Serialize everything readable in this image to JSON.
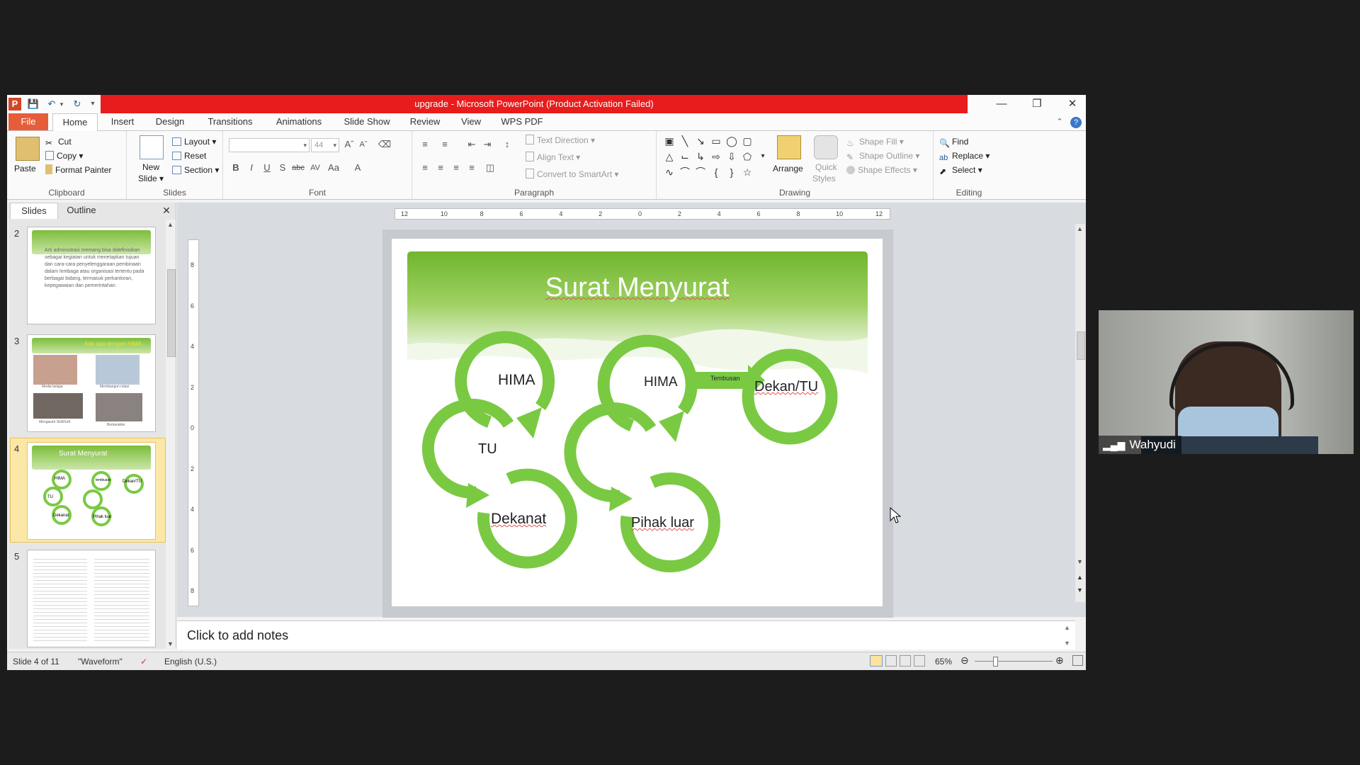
{
  "window": {
    "title": "upgrade - Microsoft PowerPoint (Product Activation Failed)",
    "accent_red": "#e81c1c"
  },
  "tabs": [
    "File",
    "Home",
    "Insert",
    "Design",
    "Transitions",
    "Animations",
    "Slide Show",
    "Review",
    "View",
    "WPS PDF"
  ],
  "ribbon": {
    "clipboard": {
      "label": "Clipboard",
      "paste": "Paste",
      "cut": "Cut",
      "copy": "Copy",
      "format_painter": "Format Painter"
    },
    "slides": {
      "label": "Slides",
      "new_slide": "New",
      "new_slide2": "Slide",
      "layout": "Layout",
      "reset": "Reset",
      "section": "Section"
    },
    "font": {
      "label": "Font",
      "size": "44"
    },
    "paragraph": {
      "label": "Paragraph",
      "text_direction": "Text Direction",
      "align_text": "Align Text",
      "convert_smartart": "Convert to SmartArt"
    },
    "drawing": {
      "label": "Drawing",
      "arrange": "Arrange",
      "quick_styles": "Quick",
      "quick_styles2": "Styles",
      "shape_fill": "Shape Fill",
      "shape_outline": "Shape Outline",
      "shape_effects": "Shape Effects"
    },
    "editing": {
      "label": "Editing",
      "find": "Find",
      "replace": "Replace",
      "select": "Select"
    }
  },
  "pane": {
    "tab_slides": "Slides",
    "tab_outline": "Outline",
    "thumbs": [
      {
        "num": "2",
        "text": "Arti administrasi memang bisa didefinisikan sebagai kegiatan untuk menetapkan tujuan dan cara-cara penyelenggaraan pembinaan dalam lembaga atau organisasi tertentu pada berbagai bidang, termasuk perkantoran, kepegawaian dan pemerintahan."
      },
      {
        "num": "3",
        "title": "Ada apa dengan HIMA",
        "c1": "Media belajar",
        "c2": "Membangun relasi",
        "c3": "Mengasah Skill/Soft",
        "c4": "Berkarakter"
      },
      {
        "num": "4",
        "title": "Surat Menyurat",
        "l1": "HIMA",
        "l2": "TU",
        "l3": "Dekanat",
        "l4": "HIMA",
        "l5": "Dekan/TU",
        "l6": "Pihak luar",
        "l7": "tembusan"
      },
      {
        "num": "5"
      }
    ]
  },
  "slide": {
    "title": "Surat Menyurat",
    "hima1": "HIMA",
    "tu": "TU",
    "dekanat": "Dekanat",
    "hima2": "HIMA",
    "tembusan": "Tembusan",
    "dekan_tu": "Dekan/TU",
    "pihak_luar": "Pihak luar",
    "green": "#7ac943"
  },
  "notes_placeholder": "Click to add notes",
  "status": {
    "slide_of": "Slide 4 of 11",
    "theme": "\"Waveform\"",
    "language": "English (U.S.)",
    "zoom": "65%"
  },
  "video": {
    "name": "Wahyudi"
  },
  "ruler": {
    "h_ticks": [
      "12",
      "10",
      "8",
      "6",
      "4",
      "2",
      "0",
      "2",
      "4",
      "6",
      "8",
      "10",
      "12"
    ],
    "v_ticks": [
      "8",
      "6",
      "4",
      "2",
      "0",
      "2",
      "4",
      "6",
      "8"
    ]
  }
}
